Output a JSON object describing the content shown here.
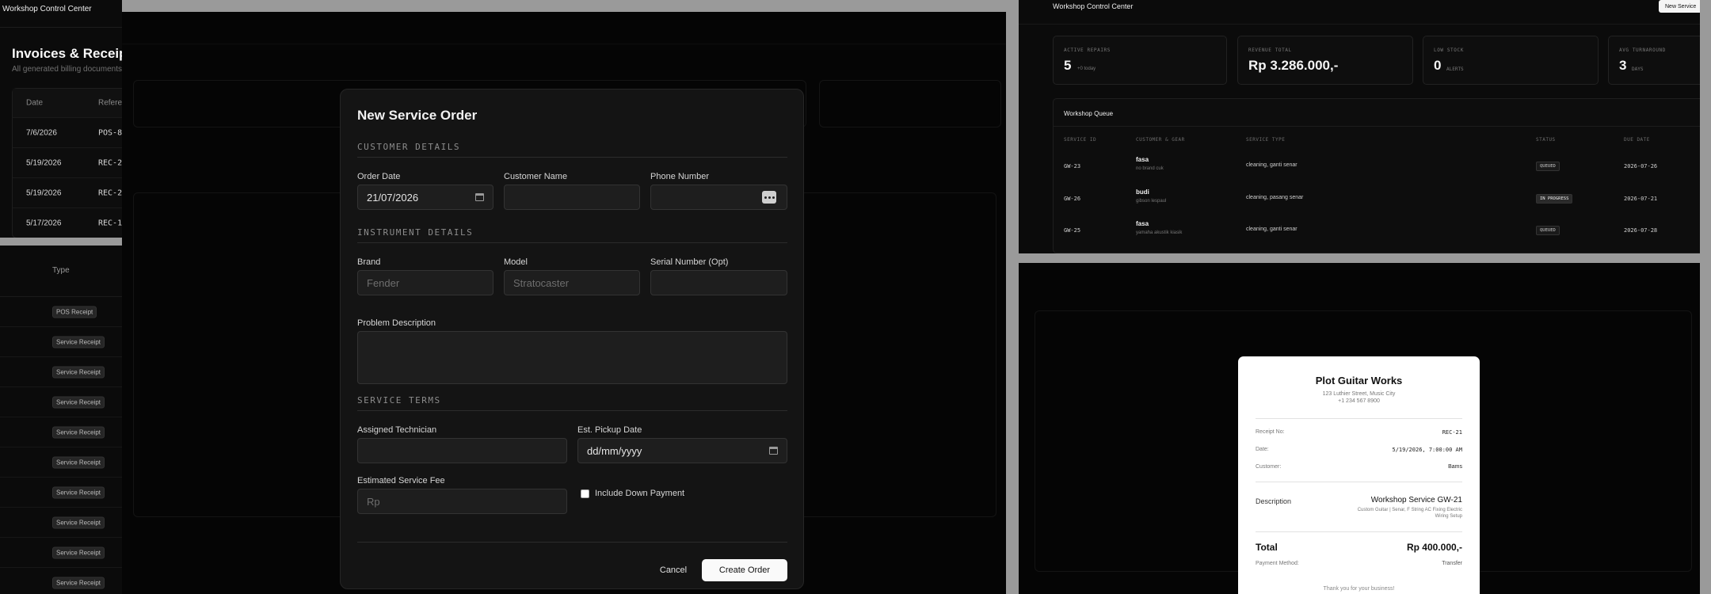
{
  "left": {
    "brand": "Workshop Control Center",
    "title": "Invoices & Receipts",
    "subtitle": "All generated billing documents",
    "table_headers": [
      "Date",
      "Referen"
    ],
    "rows": [
      {
        "date": "7/6/2026",
        "ref": "POS-8"
      },
      {
        "date": "5/19/2026",
        "ref": "REC-2"
      },
      {
        "date": "5/19/2026",
        "ref": "REC-2"
      },
      {
        "date": "5/17/2026",
        "ref": "REC-1"
      }
    ],
    "type_header": "Type",
    "types": [
      "POS Receipt",
      "Service Receipt",
      "Service Receipt",
      "Service Receipt",
      "Service Receipt",
      "Service Receipt",
      "Service Receipt",
      "Service Receipt",
      "Service Receipt",
      "Service Receipt"
    ]
  },
  "modal": {
    "title": "New Service Order",
    "sections": {
      "customer": "CUSTOMER DETAILS",
      "instrument": "INSTRUMENT DETAILS",
      "terms": "SERVICE TERMS"
    },
    "fields": {
      "order_date_label": "Order Date",
      "order_date_value": "21/07/2026",
      "customer_name_label": "Customer Name",
      "phone_label": "Phone Number",
      "brand_label": "Brand",
      "brand_placeholder": "Fender",
      "model_label": "Model",
      "model_placeholder": "Stratocaster",
      "serial_label": "Serial Number (Opt)",
      "problem_label": "Problem Description",
      "technician_label": "Assigned Technician",
      "pickup_label": "Est. Pickup Date",
      "pickup_placeholder": "dd/mm/yyyy",
      "fee_label": "Estimated Service Fee",
      "fee_placeholder": "Rp",
      "downpayment_label": "Include Down Payment"
    },
    "buttons": {
      "cancel": "Cancel",
      "create": "Create Order"
    }
  },
  "dashboard": {
    "brand": "Workshop Control Center",
    "new_service_button": "New Service",
    "stats": [
      {
        "key": "ACTIVE REPAIRS",
        "value": "5",
        "sub": "+0 today"
      },
      {
        "key": "REVENUE TOTAL",
        "value": "Rp 3.286.000,-",
        "sub": ""
      },
      {
        "key": "LOW STOCK",
        "value": "0",
        "sub": "ALERTS"
      },
      {
        "key": "AVG TURNAROUND",
        "value": "3",
        "sub": "DAYS"
      }
    ],
    "queue_title": "Workshop Queue",
    "queue_headers": [
      "SERVICE ID",
      "CUSTOMER & GEAR",
      "SERVICE TYPE",
      "STATUS",
      "DUE DATE"
    ],
    "queue_rows": [
      {
        "id": "GW-23",
        "name": "fasa",
        "gear": "no brand cuk",
        "type": "cleaning, ganti senar",
        "status": "QUEUED",
        "due": "2026-07-26"
      },
      {
        "id": "GW-26",
        "name": "budi",
        "gear": "gibson lespaul",
        "type": "cleaning, pasang senar",
        "status": "IN PROGRESS",
        "due": "2026-07-21"
      },
      {
        "id": "GW-25",
        "name": "fasa",
        "gear": "yamaha akustik kiasik",
        "type": "cleaning, ganti senar",
        "status": "QUEUED",
        "due": "2026-07-28"
      }
    ]
  },
  "receipt": {
    "shop": "Plot Guitar Works",
    "address": "123 Luthier Street, Music City",
    "phone": "+1 234 567 8900",
    "receipt_no_label": "Receipt No:",
    "receipt_no": "REC-21",
    "date_label": "Date:",
    "date": "5/19/2026, 7:00:00 AM",
    "customer_label": "Customer:",
    "customer": "Bams",
    "description_label": "Description",
    "description": "Workshop Service GW-21",
    "description_detail": "Custom Guitar | Senar, F String AC Fixing Electric Wiring Setup",
    "total_label": "Total",
    "total": "Rp 400.000,-",
    "payment_label": "Payment Method:",
    "payment": "Transfer",
    "thanks": "Thank you for your business!"
  }
}
